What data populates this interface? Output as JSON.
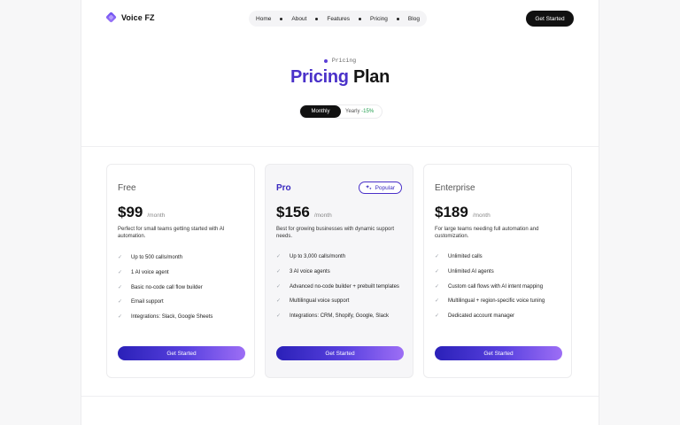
{
  "brand": {
    "name": "Voice FZ"
  },
  "nav": {
    "items": [
      "Home",
      "About",
      "Features",
      "Pricing",
      "Blog"
    ]
  },
  "header": {
    "cta_label": "Get Started"
  },
  "hero": {
    "eyebrow": "Pricing",
    "title_accent": "Pricing",
    "title_rest": "Plan",
    "toggle": {
      "monthly_label": "Monthly",
      "yearly_label": "Yearly",
      "yearly_discount": "-15%"
    }
  },
  "colors": {
    "accent": "#4a31c9",
    "dark": "#111111",
    "success": "#1f9d4d"
  },
  "plans": [
    {
      "name": "Free",
      "price": "$99",
      "period": "/month",
      "description": "Perfect for small teams getting started with AI automation.",
      "features": [
        "Up to 500 calls/month",
        "1 AI voice agent",
        "Basic no-code call flow builder",
        "Email support",
        "Integrations: Slack, Google Sheets"
      ],
      "cta_label": "Get Started"
    },
    {
      "name": "Pro",
      "badge": "Popular",
      "price": "$156",
      "period": "/month",
      "description": "Best for growing businesses with dynamic support needs.",
      "features": [
        "Up to 3,000 calls/month",
        "3 AI voice agents",
        "Advanced no-code builder + prebuilt templates",
        "Multilingual voice support",
        "Integrations: CRM, Shopify, Google, Slack"
      ],
      "cta_label": "Get Started"
    },
    {
      "name": "Enterprise",
      "price": "$189",
      "period": "/month",
      "description": "For large teams needing full automation and customization.",
      "features": [
        "Unlimited calls",
        "Unlimited AI agents",
        "Custom call flows with AI intent mapping",
        "Multilingual + region-specific voice tuning",
        "Dedicated account manager"
      ],
      "cta_label": "Get Started"
    }
  ]
}
